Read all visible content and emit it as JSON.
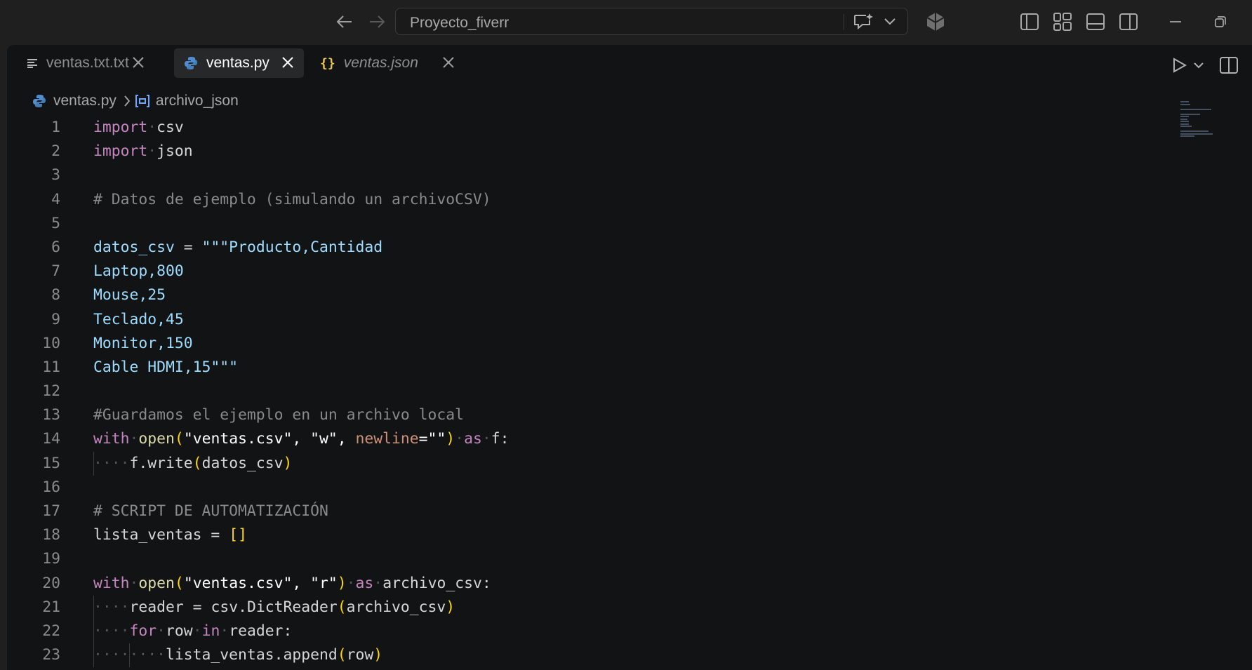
{
  "titlebar": {
    "search_text": "Proyecto_fiverr",
    "icons": [
      "arrow-left-icon",
      "arrow-right-icon",
      "chat-sparkle-icon",
      "chevron-down-icon",
      "copilot-icon",
      "toggle-primary-sidebar-icon",
      "customize-layout-icon",
      "toggle-panel-icon",
      "toggle-secondary-sidebar-icon",
      "minimize-icon",
      "restore-icon"
    ]
  },
  "tabs": [
    {
      "label": "ventas.txt.txt",
      "icon": "text-file-icon"
    },
    {
      "label": "ventas.py",
      "icon": "python-icon"
    },
    {
      "label": "ventas.json",
      "icon": "json-icon"
    }
  ],
  "editor_actions": {
    "icons": [
      "run-icon",
      "chevron-down-icon",
      "split-editor-icon"
    ]
  },
  "breadcrumb": {
    "file": "ventas.py",
    "symbol": "archivo_json"
  },
  "colors": {
    "keyword": "#c586c0",
    "variable": "#9cdcfe",
    "comment": "#8a8a8a",
    "function": "#dcdcaa",
    "param": "#ce9178",
    "bracket": "#ffd700"
  },
  "code": {
    "line_numbers": [
      "1",
      "2",
      "3",
      "4",
      "5",
      "6",
      "7",
      "8",
      "9",
      "10",
      "11",
      "12",
      "13",
      "14",
      "15",
      "16",
      "17",
      "18",
      "19",
      "20",
      "21",
      "22",
      "23"
    ],
    "l1": [
      "import",
      "csv"
    ],
    "l2": [
      "import",
      "json"
    ],
    "l4": [
      "# Datos de ejemplo (simulando un archivoCSV)"
    ],
    "l6": [
      "datos_csv",
      " = ",
      "\"\"\"Producto,Cantidad"
    ],
    "l7": [
      "Laptop,800"
    ],
    "l8": [
      "Mouse,25"
    ],
    "l9": [
      "Teclado,45"
    ],
    "l10": [
      "Monitor,150"
    ],
    "l11": [
      "Cable HDMI,15\"\"\""
    ],
    "l13": [
      "#Guardamos el ejemplo en un archivo local"
    ],
    "l14": [
      "with",
      "open",
      "(",
      "\"ventas.csv\", \"w\", ",
      "newline",
      "=\"\"",
      ")",
      "as",
      "f:"
    ],
    "l15": [
      "f.write",
      "(",
      "datos_csv",
      ")"
    ],
    "l17": [
      "# SCRIPT DE AUTOMATIZACIÓN"
    ],
    "l18": [
      "lista_ventas",
      " = ",
      "[]"
    ],
    "l20": [
      "with",
      "open",
      "(",
      "\"ventas.csv\", \"r\"",
      ")",
      "as",
      "archivo_csv:"
    ],
    "l21": [
      "reader",
      " = ",
      "csv.DictReader",
      "(",
      "archivo_csv",
      ")"
    ],
    "l22": [
      "for",
      "row",
      "in",
      "reader:"
    ],
    "l23": [
      "lista_ventas.append",
      "(",
      "row",
      ")"
    ]
  }
}
